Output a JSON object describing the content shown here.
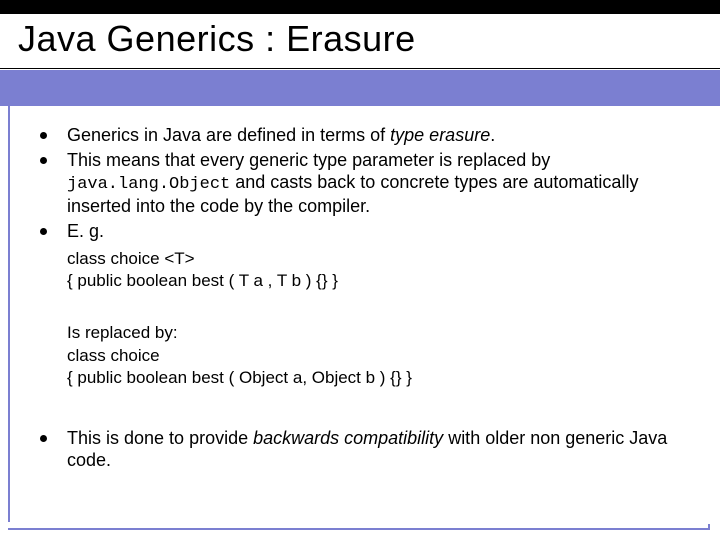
{
  "title": "Java Generics : Erasure",
  "bullets": {
    "b1_pre": "Generics in Java are defined in terms of ",
    "b1_it": "type erasure",
    "b1_post": ".",
    "b2_pre": "This means that every generic type parameter is replaced by ",
    "b2_code": "java.lang.Object",
    "b2_post": " and casts back to concrete types are automatically inserted into the code by the compiler.",
    "b3": "E. g.",
    "b4_pre": "This is done to provide ",
    "b4_it": "backwards compatibility",
    "b4_post": " with older non generic Java code."
  },
  "code1": {
    "l1": "class choice <T>",
    "l2": "{    public boolean best ( T a , T b ) {} }"
  },
  "code2": {
    "l0": "Is replaced by:",
    "l1": "class choice",
    "l2": "{    public boolean best ( Object a, Object b ) {} }"
  }
}
